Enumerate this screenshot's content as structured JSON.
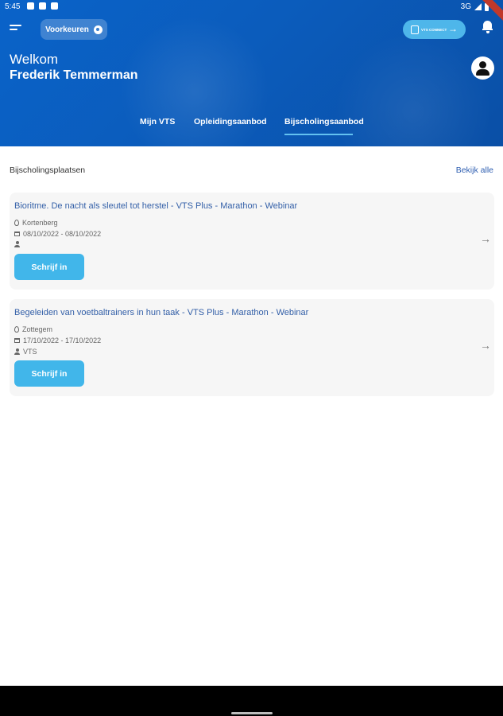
{
  "status_bar": {
    "time": "5:45",
    "network": "3G"
  },
  "header": {
    "preferences_label": "Voorkeuren",
    "connect_button": {
      "logo_text": "VTS CONNECT",
      "arrow": "→"
    },
    "welcome": "Welkom",
    "user_name": "Frederik Temmerman",
    "tabs": [
      {
        "label": "Mijn VTS",
        "active": false
      },
      {
        "label": "Opleidingsaanbod",
        "active": false
      },
      {
        "label": "Bijscholingsaanbod",
        "active": true
      }
    ]
  },
  "section": {
    "title": "Bijscholingsplaatsen",
    "see_all": "Bekijk alle"
  },
  "courses": [
    {
      "title": "Bioritme. De nacht als sleutel tot herstel - VTS Plus - Marathon - Webinar",
      "location": "Kortenberg",
      "dates": "08/10/2022 - 08/10/2022",
      "organizer": "",
      "button": "Schrijf in"
    },
    {
      "title": "Begeleiden van voetbaltrainers in hun taak - VTS Plus - Marathon - Webinar",
      "location": "Zottegem",
      "dates": "17/10/2022 - 17/10/2022",
      "organizer": "VTS",
      "button": "Schrijf in"
    }
  ],
  "colors": {
    "header": "#0a5cbf",
    "accent": "#41b6ea",
    "link": "#3460a8"
  }
}
